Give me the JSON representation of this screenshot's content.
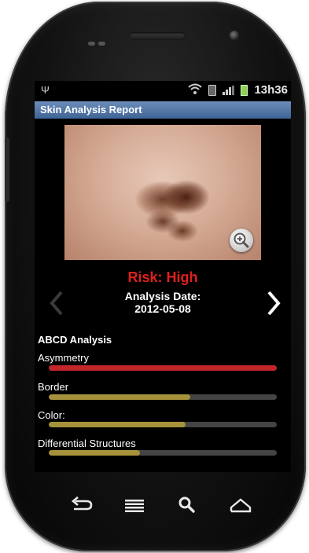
{
  "status_bar": {
    "time": "13h36"
  },
  "app": {
    "title": "Skin Analysis Report"
  },
  "report": {
    "risk": "Risk: High",
    "date_label": "Analysis Date:",
    "date_value": "2012-05-08"
  },
  "abcd": {
    "title": "ABCD Analysis",
    "metrics": [
      {
        "label": "Asymmetry",
        "level": 1.0,
        "color": "#c0262a"
      },
      {
        "label": "Border",
        "level": 0.62,
        "color": "#a6923a"
      },
      {
        "label": "Color:",
        "level": 0.6,
        "color": "#a6923a"
      },
      {
        "label": "Differential Structures",
        "level": 0.4,
        "color": "#a6923a"
      }
    ]
  },
  "icons": {
    "zoom": "zoom-in-icon",
    "prev": "chevron-left-icon",
    "next": "chevron-right-icon",
    "back": "back-icon",
    "menu": "menu-icon",
    "search": "search-icon",
    "home": "home-icon"
  },
  "colors": {
    "title_bar": "#4f74a8",
    "risk_text": "#e0201c",
    "bar_track": "#444444"
  }
}
